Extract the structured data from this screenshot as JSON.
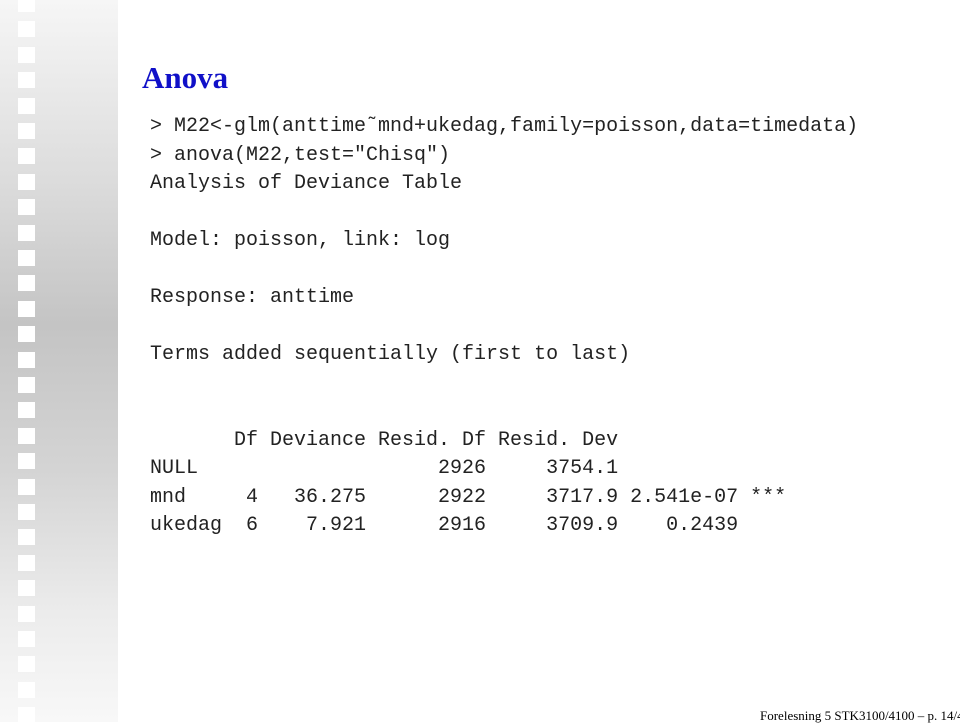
{
  "slide": {
    "title": "Anova",
    "lines": [
      "> M22<-glm(anttime˜mnd+ukedag,family=poisson,data=timedata)",
      "> anova(M22,test=\"Chisq\")",
      "Analysis of Deviance Table",
      "",
      "Model: poisson, link: log",
      "",
      "Response: anttime",
      "",
      "Terms added sequentially (first to last)",
      "",
      "",
      "       Df Deviance Resid. Df Resid. Dev",
      "NULL                    2926     3754.1",
      "mnd     4   36.275      2922     3717.9 2.541e-07 ***",
      "ukedag  6    7.921      2916     3709.9    0.2439"
    ],
    "footer": "Forelesning 5 STK3100/4100  – p. 14/4"
  }
}
